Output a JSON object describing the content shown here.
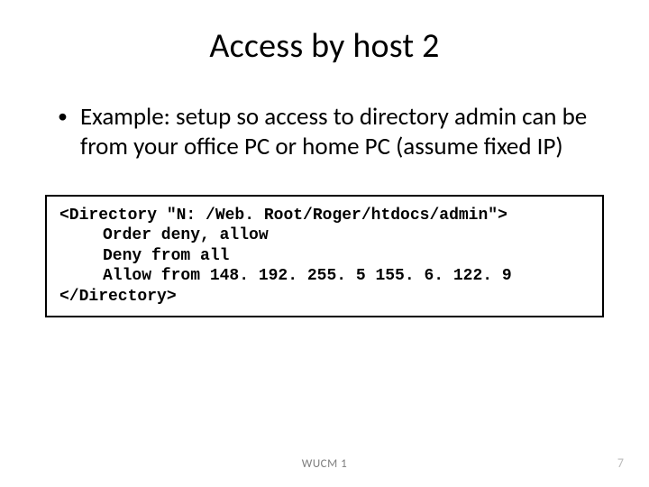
{
  "title": "Access by host 2",
  "bullet_text": "Example: setup so access to directory admin can be from your office PC or home PC (assume fixed IP)",
  "code": {
    "line1": "<Directory \"N: /Web. Root/Roger/htdocs/admin\">",
    "line2": "Order deny, allow",
    "line3": "Deny from all",
    "line4": "Allow from 148. 192. 255. 5 155. 6. 122. 9",
    "line5": "</Directory>"
  },
  "footer_center": "WUCM 1",
  "page_number": "7"
}
